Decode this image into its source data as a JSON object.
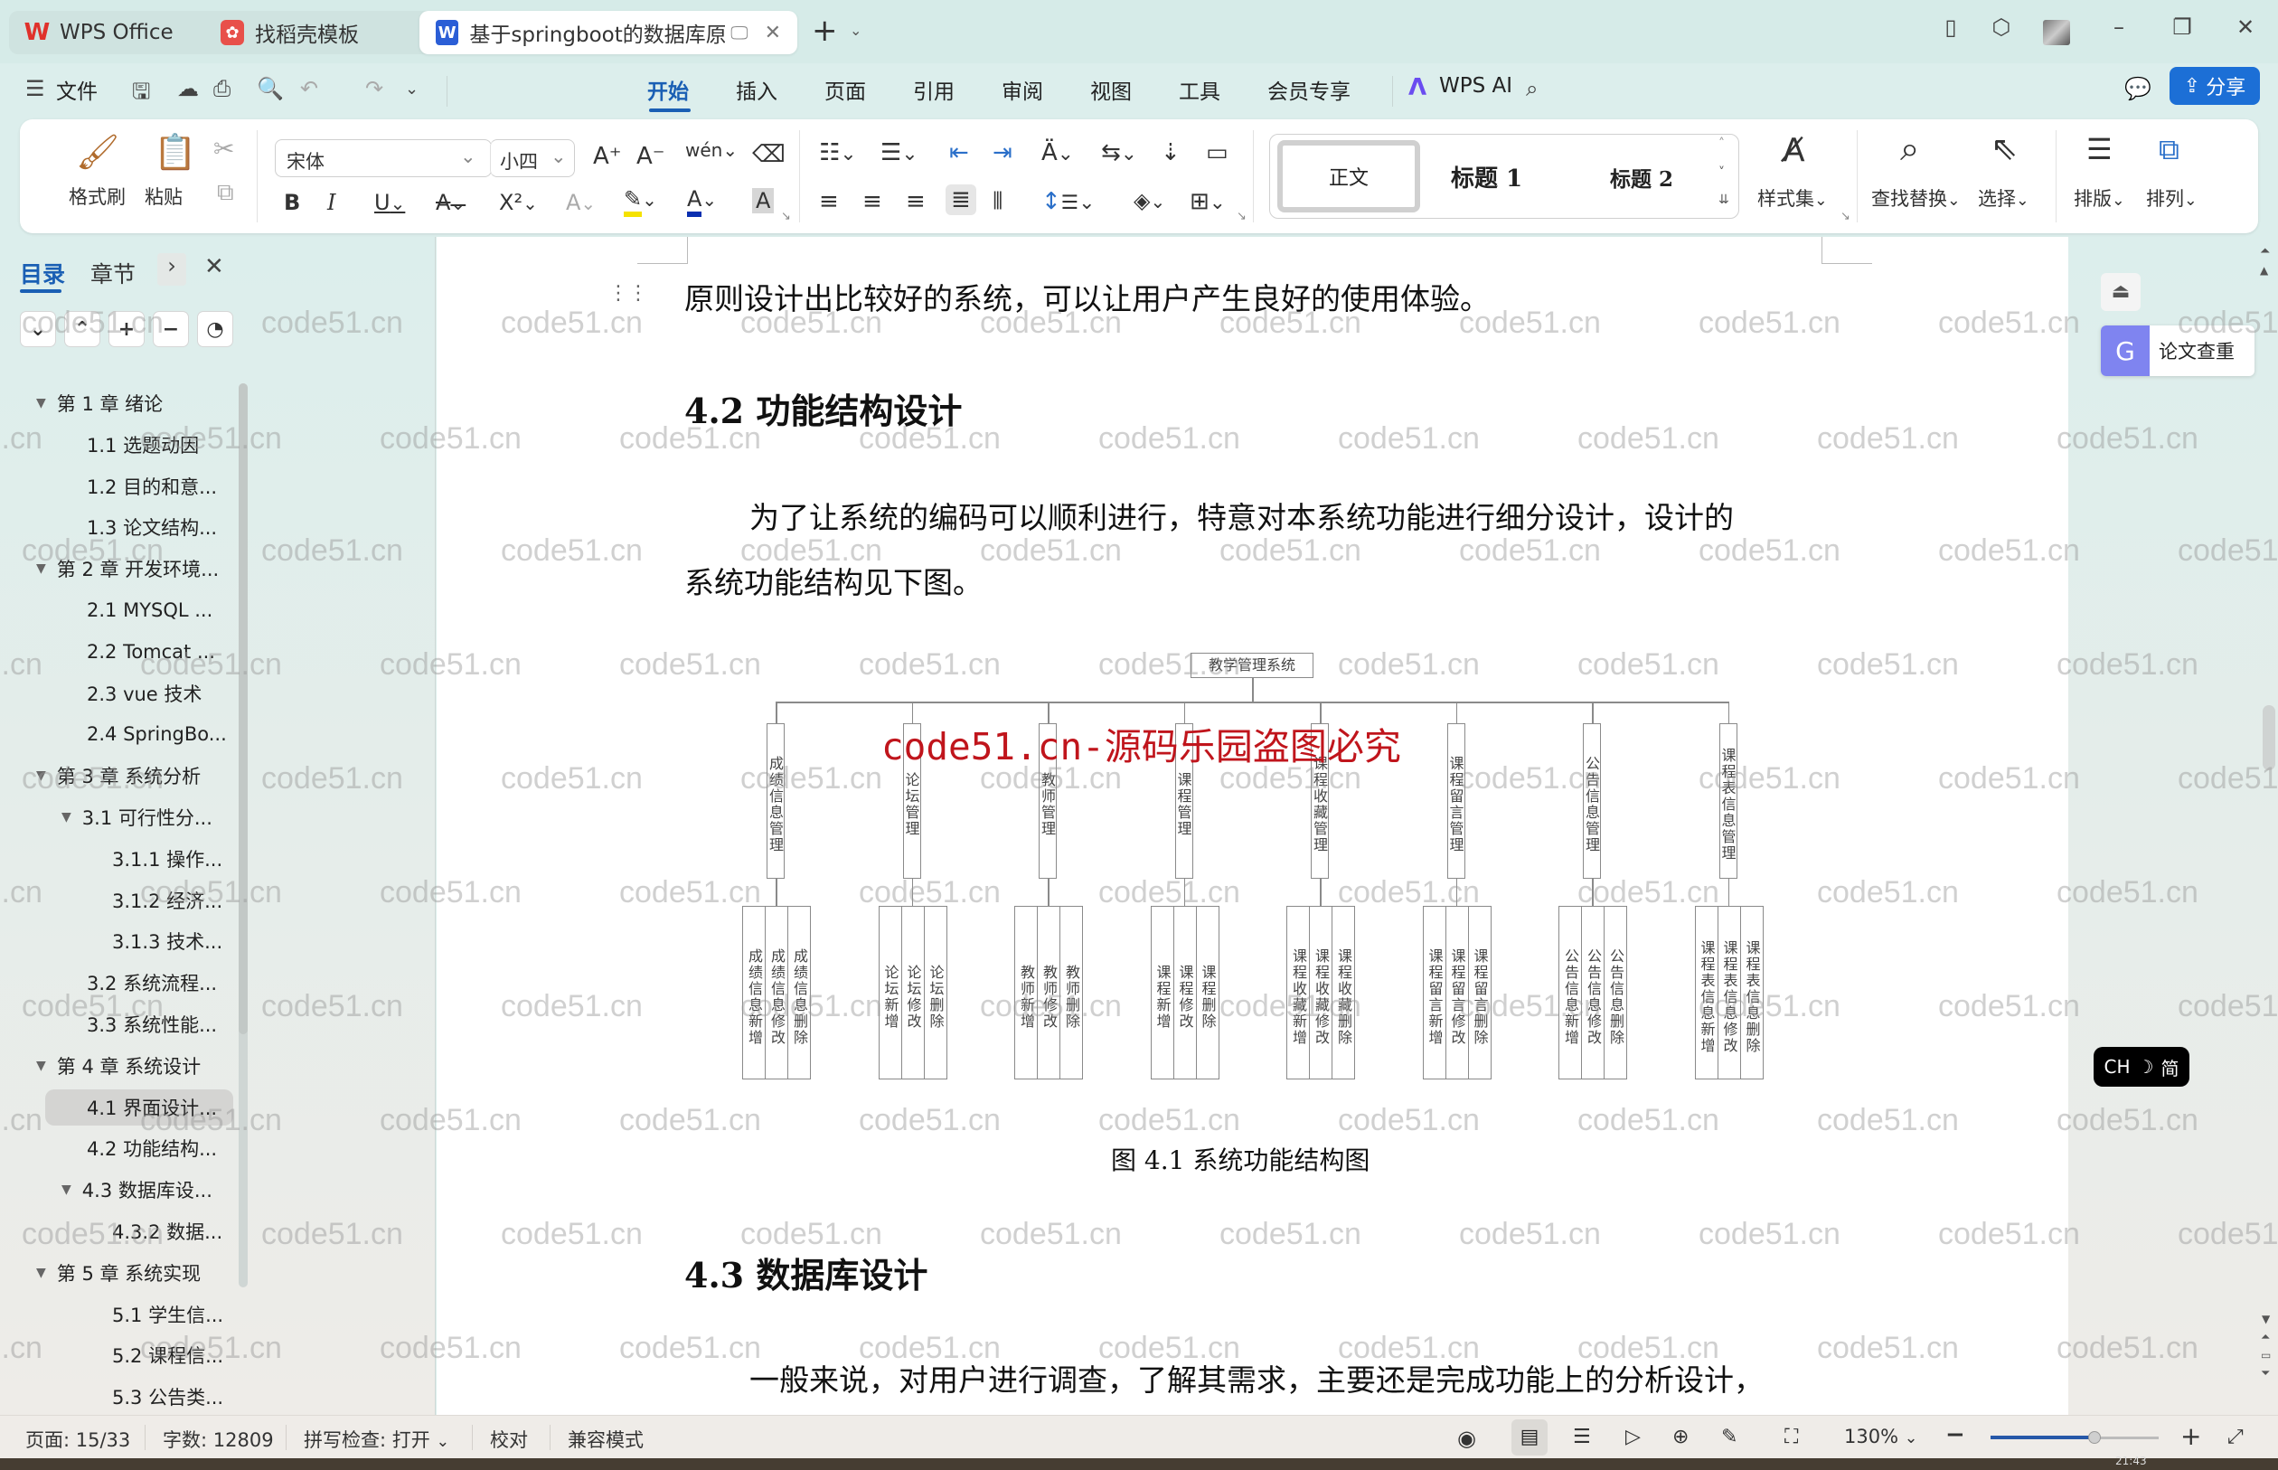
{
  "tabs": [
    {
      "label": "WPS Office",
      "icon": "wps-logo-icon",
      "active": false
    },
    {
      "label": "找稻壳模板",
      "icon": "docer-icon",
      "active": false
    },
    {
      "label": "基于springboot的数据库原理",
      "icon": "word-doc-icon",
      "active": true
    }
  ],
  "window_controls": {
    "minimize": "–",
    "maximize": "❐",
    "close": "✕"
  },
  "menu": {
    "file_label": "文件",
    "items": [
      "开始",
      "插入",
      "页面",
      "引用",
      "审阅",
      "视图",
      "工具",
      "会员专享"
    ],
    "active_item": "开始",
    "wps_ai_label": "WPS AI",
    "share_label": "分享"
  },
  "ribbon": {
    "format_painter": "格式刷",
    "paste": "粘贴",
    "font_name": "宋体",
    "font_size": "小四",
    "styles": [
      "正文",
      "标题 1",
      "标题 2"
    ],
    "style_set": "样式集",
    "find_replace": "查找替换",
    "select": "选择",
    "typeset": "排版",
    "arrange": "排列",
    "bold": "B",
    "italic": "I",
    "underline": "U",
    "strikethrough": "A",
    "superscript": "X²",
    "text_effect": "A",
    "font_color": "A",
    "char_shading": "A",
    "pinyin": "wén",
    "grow_font": "A⁺",
    "shrink_font": "A⁻"
  },
  "sidebar": {
    "tabs": [
      "目录",
      "章节"
    ],
    "active_tab": "目录",
    "toc": [
      {
        "label": "第 1 章  绪论",
        "level": 0,
        "caret": true
      },
      {
        "label": "1.1 选题动因",
        "level": 1,
        "caret": false
      },
      {
        "label": "1.2 目的和意...",
        "level": 1,
        "caret": false
      },
      {
        "label": "1.3 论文结构...",
        "level": 1,
        "caret": false
      },
      {
        "label": "第 2 章  开发环境...",
        "level": 0,
        "caret": true
      },
      {
        "label": "2.1 MYSQL ...",
        "level": 1,
        "caret": false
      },
      {
        "label": "2.2 Tomcat  ...",
        "level": 1,
        "caret": false
      },
      {
        "label": "2.3 vue 技术",
        "level": 1,
        "caret": false
      },
      {
        "label": "2.4 SpringBo...",
        "level": 1,
        "caret": false
      },
      {
        "label": "第 3 章  系统分析",
        "level": 0,
        "caret": true
      },
      {
        "label": "3.1 可行性分...",
        "level": 1,
        "caret": true
      },
      {
        "label": "3.1.1 操作...",
        "level": 2,
        "caret": false
      },
      {
        "label": "3.1.2 经济...",
        "level": 2,
        "caret": false
      },
      {
        "label": "3.1.3 技术...",
        "level": 2,
        "caret": false
      },
      {
        "label": "3.2 系统流程...",
        "level": 1,
        "caret": false
      },
      {
        "label": "3.3 系统性能...",
        "level": 1,
        "caret": false
      },
      {
        "label": "第 4 章  系统设计",
        "level": 0,
        "caret": true
      },
      {
        "label": "4.1 界面设计...",
        "level": 1,
        "caret": false,
        "selected": true
      },
      {
        "label": "4.2 功能结构...",
        "level": 1,
        "caret": false
      },
      {
        "label": "4.3 数据库设...",
        "level": 1,
        "caret": true
      },
      {
        "label": "4.3.2  数据...",
        "level": 2,
        "caret": false
      },
      {
        "label": "第 5 章  系统实现",
        "level": 0,
        "caret": true
      },
      {
        "label": "5.1 学生信...",
        "level": 2,
        "caret": false
      },
      {
        "label": "5.2  课程信...",
        "level": 2,
        "caret": false
      },
      {
        "label": "5.3 公告类...",
        "level": 2,
        "caret": false
      }
    ]
  },
  "document": {
    "line1": "原则设计出比较好的系统，可以让用户产生良好的使用体验。",
    "heading_42": "4.2 功能结构设计",
    "para1_line1": "为了让系统的编码可以顺利进行，特意对本系统功能进行细分设计，设计的",
    "para1_line2": "系统功能结构见下图。",
    "figure_caption": "图 4.1  系统功能结构图",
    "heading_43": "4.3 数据库设计",
    "para2_line1": "一般来说，对用户进行调查，了解其需求，主要还是完成功能上的分析设计，",
    "stamp": "code51.cn-源码乐园盗图必究",
    "watermark": "code51.cn"
  },
  "diagram": {
    "root": "教学管理系统",
    "modules": [
      {
        "name": "成绩信息管理",
        "children": [
          "成绩信息新增",
          "成绩信息修改",
          "成绩信息删除"
        ]
      },
      {
        "name": "论坛管理",
        "children": [
          "论坛新增",
          "论坛修改",
          "论坛删除"
        ]
      },
      {
        "name": "教师管理",
        "children": [
          "教师新增",
          "教师修改",
          "教师删除"
        ]
      },
      {
        "name": "课程管理",
        "children": [
          "课程新增",
          "课程修改",
          "课程删除"
        ]
      },
      {
        "name": "课程收藏管理",
        "children": [
          "课程收藏新增",
          "课程收藏修改",
          "课程收藏删除"
        ]
      },
      {
        "name": "课程留言管理",
        "children": [
          "课程留言新增",
          "课程留言修改",
          "课程留言删除"
        ]
      },
      {
        "name": "公告信息管理",
        "children": [
          "公告信息新增",
          "公告信息修改",
          "公告信息删除"
        ]
      },
      {
        "name": "课程表信息管理",
        "children": [
          "课程表信息新增",
          "课程表信息修改",
          "课程表信息删除"
        ]
      }
    ]
  },
  "right_panel": {
    "paper_check_label": "论文查重",
    "ime_label": "CH",
    "ime_mode": "简"
  },
  "statusbar": {
    "page": "页面: 15/33",
    "words": "字数: 12809",
    "spellcheck": "拼写检查: 打开",
    "proofread": "校对",
    "compat_mode": "兼容模式",
    "zoom": "130%",
    "zoom_level_fraction": 0.62
  },
  "taskbar": {
    "clock": "21:43"
  }
}
